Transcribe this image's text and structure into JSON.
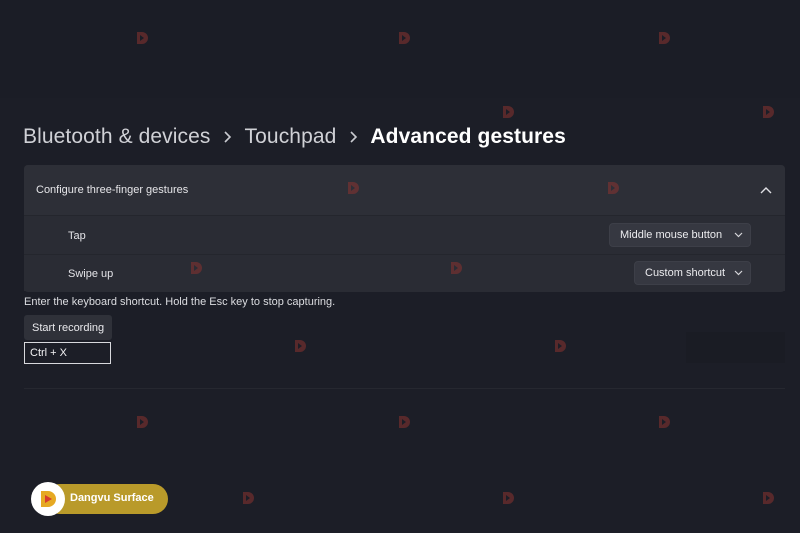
{
  "breadcrumb": {
    "items": [
      "Bluetooth & devices",
      "Touchpad",
      "Advanced gestures"
    ]
  },
  "panel": {
    "title": "Configure three-finger gestures",
    "rows": [
      {
        "label": "Tap",
        "value": "Middle mouse button"
      },
      {
        "label": "Swipe up",
        "value": "Custom shortcut"
      }
    ]
  },
  "shortcut": {
    "instruction": "Enter the keyboard shortcut. Hold the Esc key to stop capturing.",
    "start_label": "Start recording",
    "value": "Ctrl + X"
  },
  "watermark": {
    "brand_name": "Dangvu Surface"
  },
  "colors": {
    "background": "#1c1e27",
    "panel": "#2a2c34",
    "brand_gold": "#b99a2a",
    "watermark_red": "#c0392b"
  }
}
